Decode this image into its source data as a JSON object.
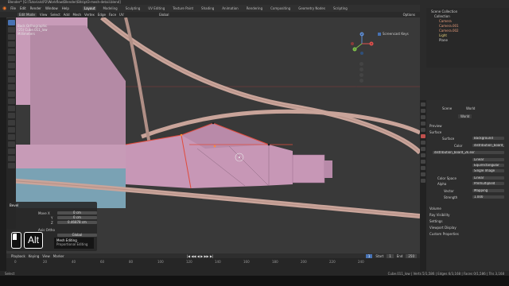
{
  "window": {
    "title": "Blender* [G:\\Tutorials\\P2\\Workflow\\Blender\\Bits\\pt3-mesh-detail.blend]"
  },
  "menu": {
    "items": [
      "File",
      "Edit",
      "Render",
      "Window",
      "Help"
    ]
  },
  "workspaces": [
    "Layout",
    "Modeling",
    "Sculpting",
    "UV Editing",
    "Texture Paint",
    "Shading",
    "Animation",
    "Rendering",
    "Compositing",
    "Geometry Nodes",
    "Scripting"
  ],
  "active_workspace": "Layout",
  "scene": {
    "label": "Scene",
    "view_layer": "ViewLayer"
  },
  "tool_settings": {
    "mode": "Edit Mode",
    "view": "View",
    "select": "Select",
    "add": "Add",
    "mesh": "Mesh",
    "vertex": "Vertex",
    "edge": "Edge",
    "face": "Face",
    "uv": "UV",
    "orientation": "Global",
    "options": "Options"
  },
  "viewport_info": {
    "line1": "Back Orthographic",
    "line2": "(25) Cube.011_low",
    "line3": "Millimeters"
  },
  "nav_gizmo": {
    "x": "X",
    "y": "Y",
    "z": "Z"
  },
  "screencast_keys": "Screencast Keys",
  "redo_panel": {
    "title": "Bevel",
    "rows": [
      {
        "label": "Move X",
        "value": "0 cm"
      },
      {
        "label": "Y",
        "value": "0 cm"
      },
      {
        "label": "Z",
        "value": "0.46878 cm"
      }
    ],
    "orientation_label": "Axis Ortho",
    "orientation_value": "Global"
  },
  "key_overlay": {
    "key": "Alt"
  },
  "tooltip": {
    "title": "Mesh Editing",
    "sub": "Proportional Editing"
  },
  "timeline": {
    "header": [
      "Playback",
      "Keying",
      "View",
      "Marker"
    ],
    "frames": [
      "0",
      "20",
      "40",
      "60",
      "80",
      "100",
      "120",
      "140",
      "160",
      "180",
      "200",
      "220",
      "240"
    ],
    "current_frame": "1",
    "start_label": "Start",
    "start": "1",
    "end_label": "End",
    "end": "250"
  },
  "statusbar": {
    "left": "Select",
    "right": "Cube.011_low | Verts 5/1,586 | Edges 6/3,168 | Faces 0/1,586 | Tris 3,168"
  },
  "outliner": {
    "title": "Scene Collection",
    "items": [
      "Collection",
      "Camera",
      "Camera.001",
      "Camera.002",
      "Light",
      "Plane"
    ]
  },
  "properties": {
    "breadcrumb": [
      "Scene",
      "World"
    ],
    "world_name": "World",
    "sections": [
      "Preview",
      "Surface"
    ],
    "rows": [
      {
        "label": "Surface",
        "value": "Background"
      },
      {
        "label": "Color",
        "value": "distribution_board_2k.exr"
      }
    ],
    "image_name": "distribution_board_2k.exr",
    "fields": [
      {
        "value": "Linear"
      },
      {
        "value": "Equirectangular"
      },
      {
        "value": "Single Image"
      }
    ],
    "color_space": {
      "label": "Color Space",
      "value": "Linear"
    },
    "alpha": {
      "label": "Alpha",
      "value": "Premultiplied"
    },
    "vector": {
      "label": "Vector",
      "value": "Mapping"
    },
    "strength": {
      "label": "Strength",
      "value": "1.000"
    },
    "closed_sections": [
      "Volume",
      "Ray Visibility",
      "Settings",
      "Viewport Display",
      "Custom Properties"
    ]
  },
  "colors": {
    "accent": "#4772b3",
    "mesh_pink": "#c797b6",
    "wire_red": "#e04b3c",
    "pipe": "#c9a49a",
    "floor_blue": "#7aa2b4"
  }
}
